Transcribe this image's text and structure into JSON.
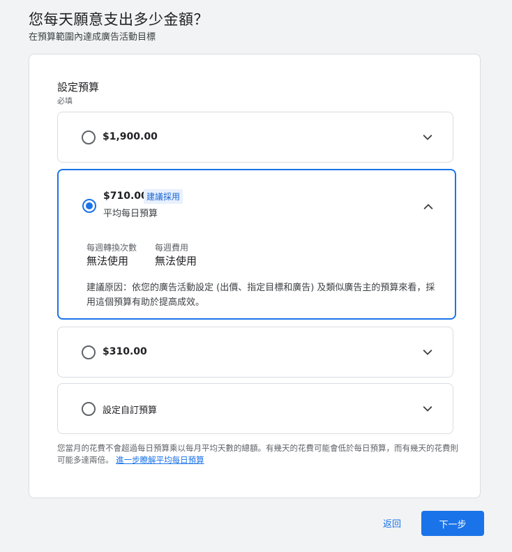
{
  "header": {
    "title": "您每天願意支出多少金額？",
    "subtitle": "在預算範圍內達成廣告活動目標"
  },
  "budget": {
    "section_title": "設定預算",
    "required_label": "必填",
    "options": [
      {
        "label": "$1,900.00",
        "selected": false
      },
      {
        "label": "$710.00",
        "badge": "建議採用",
        "sublabel": "平均每日預算",
        "selected": true,
        "stats": [
          {
            "label": "每週轉換次數",
            "value": "無法使用"
          },
          {
            "label": "每週費用",
            "value": "無法使用"
          }
        ],
        "reason": "建議原因：依您的廣告活動設定 (出價、指定目標和廣告) 及類似廣告主的預算來看，採用這個預算有助於提高成效。"
      },
      {
        "label": "$310.00",
        "selected": false
      },
      {
        "label": "設定自訂預算",
        "selected": false
      }
    ],
    "footnote": "您當月的花費不會超過每日預算乘以每月平均天數的總額。有幾天的花費可能會低於每日預算，而有幾天的花費則可能多達兩倍。",
    "footnote_link": "進一步瞭解平均每日預算"
  },
  "footer": {
    "back_label": "返回",
    "next_label": "下一步"
  },
  "colors": {
    "accent": "#1a73e8",
    "background": "#f1f3f4"
  }
}
